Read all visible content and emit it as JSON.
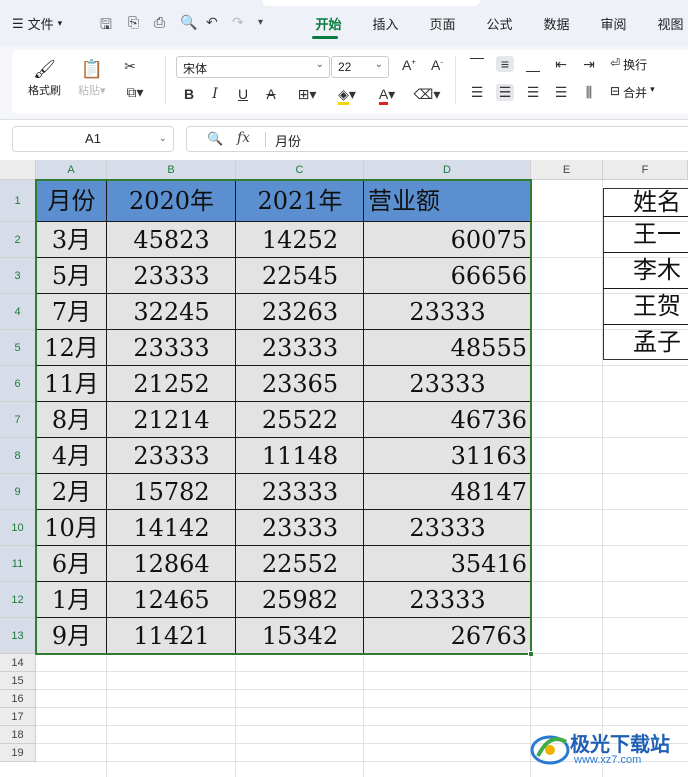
{
  "menubar": {
    "file_label": "文件",
    "tabs": [
      {
        "label": "开始",
        "active": true
      },
      {
        "label": "插入",
        "active": false
      },
      {
        "label": "页面",
        "active": false
      },
      {
        "label": "公式",
        "active": false
      },
      {
        "label": "数据",
        "active": false
      },
      {
        "label": "审阅",
        "active": false
      },
      {
        "label": "视图",
        "active": false
      }
    ]
  },
  "ribbon": {
    "format_painter": "格式刷",
    "paste": "粘贴",
    "font_name": "宋体",
    "font_size": "22",
    "wrap_label": "换行",
    "merge_label": "合并"
  },
  "formula_bar": {
    "cell_ref": "A1",
    "content": "月份"
  },
  "grid": {
    "columns": [
      "A",
      "B",
      "C",
      "D",
      "E",
      "F"
    ],
    "row_numbers": [
      "1",
      "2",
      "3",
      "4",
      "5",
      "6",
      "7",
      "8",
      "9",
      "10",
      "11",
      "12",
      "13",
      "14",
      "15",
      "16",
      "17",
      "18",
      "19"
    ],
    "header_row": [
      "月份",
      "2020年",
      "2021年",
      "营业额"
    ],
    "rows": [
      [
        "3月",
        "45823",
        "14252",
        "60075"
      ],
      [
        "5月",
        "23333",
        "22545",
        "66656"
      ],
      [
        "7月",
        "32245",
        "23263",
        "23333"
      ],
      [
        "12月",
        "23333",
        "23333",
        "48555"
      ],
      [
        "11月",
        "21252",
        "23365",
        "23333"
      ],
      [
        "8月",
        "21214",
        "25522",
        "46736"
      ],
      [
        "4月",
        "23333",
        "11148",
        "31163"
      ],
      [
        "2月",
        "15782",
        "23333",
        "48147"
      ],
      [
        "10月",
        "14142",
        "23333",
        "23333"
      ],
      [
        "6月",
        "12864",
        "22552",
        "35416"
      ],
      [
        "1月",
        "12465",
        "25982",
        "23333"
      ],
      [
        "9月",
        "11421",
        "15342",
        "26763"
      ]
    ],
    "d_alignment": [
      "right",
      "right",
      "center",
      "right",
      "center",
      "right",
      "right",
      "right",
      "center",
      "right",
      "center",
      "right"
    ],
    "f_column": [
      "姓名",
      "王一",
      "李木",
      "王贺",
      "孟子"
    ]
  },
  "watermark": {
    "title": "极光下载站",
    "url": "www.xz7.com"
  },
  "colors": {
    "accent": "#0b7a3f",
    "selection": "#2e7d32",
    "header_fill": "#5b8fd0",
    "range_fill": "#e3e3e3"
  }
}
